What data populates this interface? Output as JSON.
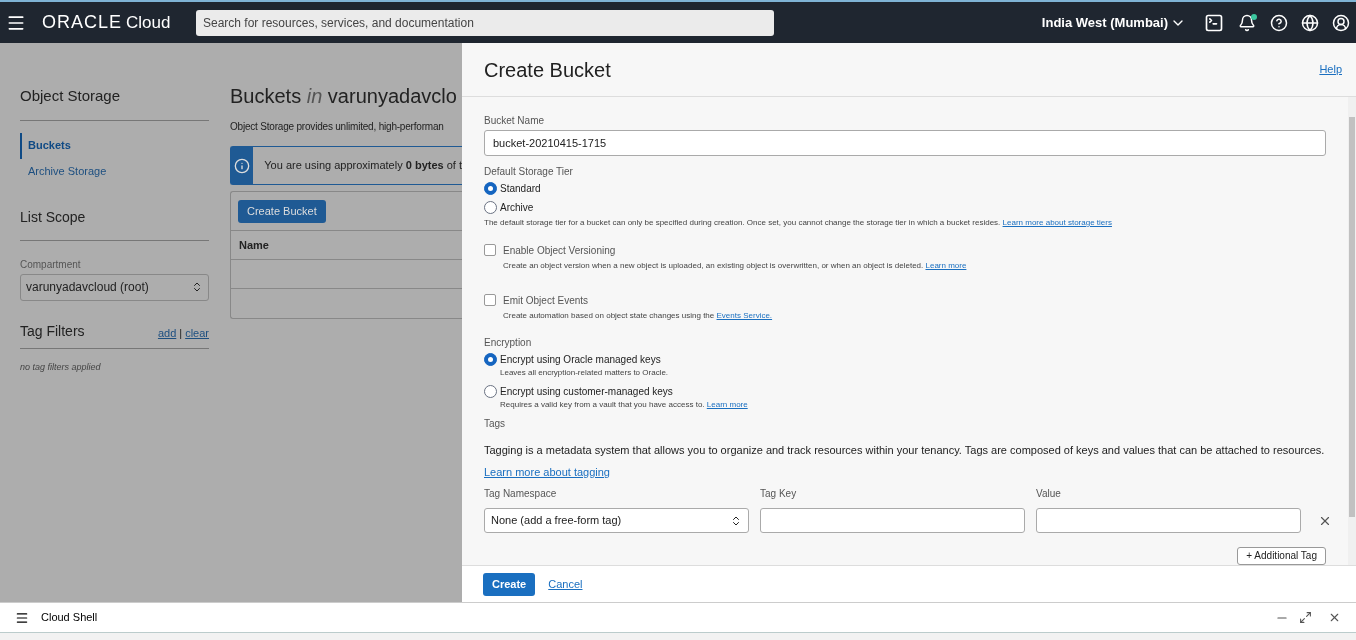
{
  "header": {
    "logo_brand": "ORACLE",
    "logo_product": "Cloud",
    "search": {
      "placeholder": "Search for resources, services, and documentation"
    },
    "region": "India West (Mumbai)",
    "notification_dot": true
  },
  "sidebar": {
    "title": "Object Storage",
    "items": [
      {
        "label": "Buckets",
        "selected": true
      },
      {
        "label": "Archive Storage",
        "selected": false
      }
    ],
    "scope_title": "List Scope",
    "compartment_label": "Compartment",
    "compartment_value": "varunyadavcloud (root)",
    "tag_filters_title": "Tag Filters",
    "tag_links": [
      "add",
      "clear"
    ],
    "tag_separator": "|",
    "no_filters": "no tag filters applied"
  },
  "main": {
    "title_prefix": "Buckets",
    "title_in": "in",
    "title_rest": "varunyadavclo",
    "description": "Object Storage provides unlimited, high-performan",
    "notice": "You are using approximately **0 bytes** of t",
    "create_button": "Create Bucket",
    "columns": [
      "Name"
    ]
  },
  "panel": {
    "title": "Create Bucket",
    "help": "Help",
    "bucket_name": {
      "label": "Bucket Name",
      "value": "bucket-20210415-1715"
    },
    "storage_tier": {
      "label": "Default Storage Tier",
      "options": [
        {
          "label": "Standard",
          "selected": true
        },
        {
          "label": "Archive",
          "selected": false
        }
      ],
      "note": "The default storage tier for a bucket can only be specified during creation. Once set, you cannot change the storage tier in which a bucket resides.",
      "link": "Learn more about storage tiers"
    },
    "checkboxes": [
      {
        "label": "Enable Object Versioning",
        "checked": false,
        "note": "Create an object version when a new object is uploaded, an existing object is overwritten, or when an object is deleted.",
        "link": "Learn more"
      },
      {
        "label": "Emit Object Events",
        "checked": false,
        "note": "Create automation based on object state changes using the",
        "link": "Events Service."
      }
    ],
    "encryption": {
      "label": "Encryption",
      "options": [
        {
          "label": "Encrypt using Oracle managed keys",
          "selected": true,
          "note": "Leaves all encryption-related matters to Oracle."
        },
        {
          "label": "Encrypt using customer-managed keys",
          "selected": false,
          "note": "Requires a valid key from a vault that you have access to.",
          "link": "Learn more"
        }
      ]
    },
    "tags": {
      "label": "Tags",
      "description": "Tagging is a metadata system that allows you to organize and track resources within your tenancy. Tags are composed of keys and values that can be attached to resources.",
      "link": "Learn more about tagging",
      "columns": [
        "Tag Namespace",
        "Tag Key",
        "Value"
      ],
      "namespace_value": "None (add a free-form tag)",
      "add_button": "+ Additional Tag"
    },
    "buttons": {
      "primary": "Create",
      "secondary": "Cancel"
    }
  },
  "cloud_shell": {
    "title": "Cloud Shell"
  }
}
